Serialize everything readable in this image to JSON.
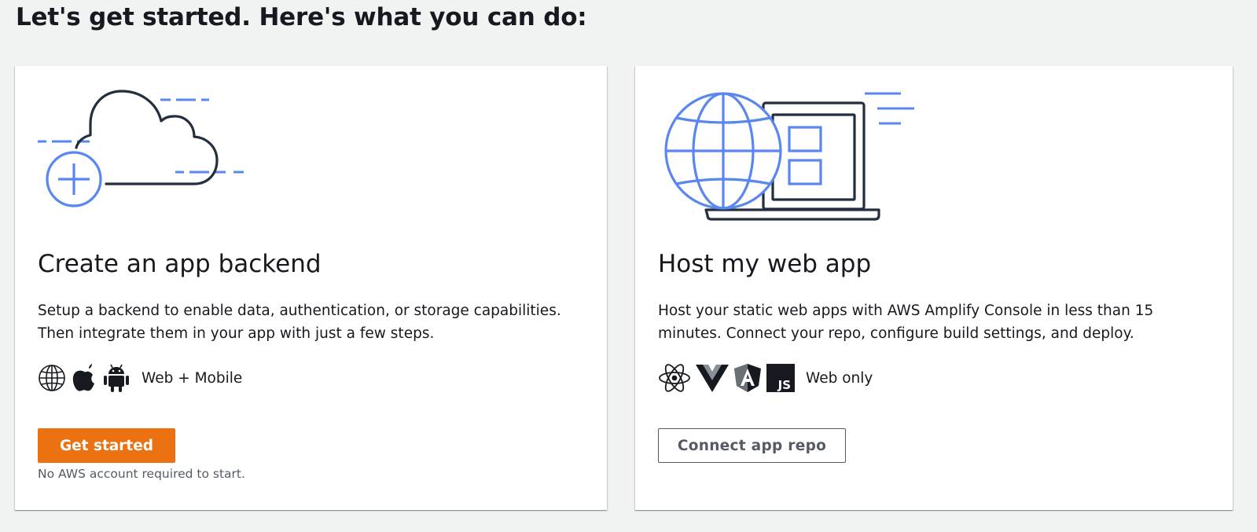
{
  "page": {
    "heading": "Let's get started. Here's what you can do:"
  },
  "cards": [
    {
      "title": "Create an app backend",
      "description": "Setup a backend to enable data, authentication, or storage capabilities. Then integrate them in your app with just a few steps.",
      "platform_icons": [
        "globe-icon",
        "apple-icon",
        "android-icon"
      ],
      "platform_label": "Web + Mobile",
      "button_label": "Get started",
      "hint": "No AWS account required to start."
    },
    {
      "title": "Host my web app",
      "description": "Host your static web apps with AWS Amplify Console in less than 15 minutes. Connect your repo, configure build settings, and deploy.",
      "platform_icons": [
        "react-icon",
        "vue-icon",
        "angular-icon",
        "javascript-icon"
      ],
      "platform_label": "Web only",
      "button_label": "Connect app repo"
    }
  ],
  "colors": {
    "background": "#f1f2f2",
    "card": "#ffffff",
    "primary_button": "#ec7211",
    "illustration_accent": "#5a86f0",
    "illustration_outline": "#232f3e",
    "text": "#16191f",
    "secondary_text": "#545b64"
  }
}
